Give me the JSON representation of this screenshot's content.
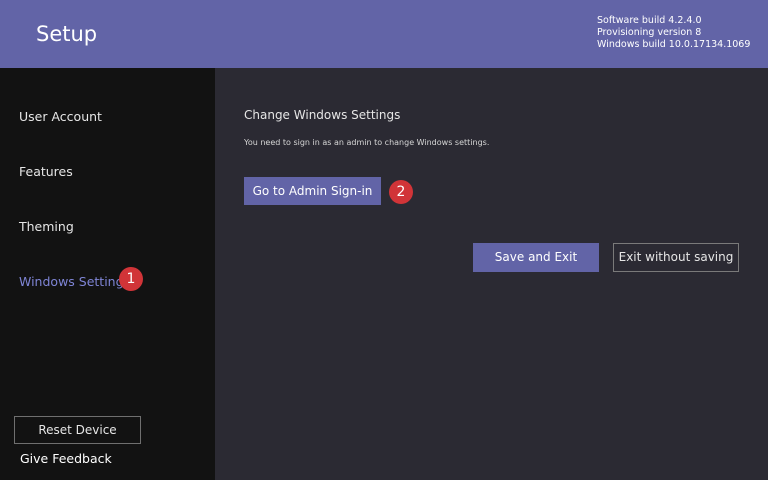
{
  "header": {
    "title": "Setup",
    "build_info": [
      "Software build 4.2.4.0",
      "Provisioning version 8",
      "Windows build 10.0.17134.1069"
    ]
  },
  "sidebar": {
    "items": [
      {
        "label": "User Account",
        "active": false
      },
      {
        "label": "Features",
        "active": false
      },
      {
        "label": "Theming",
        "active": false
      },
      {
        "label": "Windows Settings",
        "active": true
      }
    ],
    "reset_label": "Reset Device",
    "feedback_label": "Give Feedback"
  },
  "main": {
    "title": "Change Windows Settings",
    "description": "You need to sign in as an admin to change Windows settings.",
    "admin_signin_label": "Go to Admin Sign-in",
    "save_exit_label": "Save and Exit",
    "exit_nosave_label": "Exit without saving"
  },
  "annotations": {
    "badge_1": "1",
    "badge_2": "2"
  },
  "colors": {
    "accent": "#6264a7",
    "sidebar_bg": "#121212",
    "content_bg": "#2b2a33",
    "active_nav": "#7f85d6",
    "badge": "#d13438"
  }
}
